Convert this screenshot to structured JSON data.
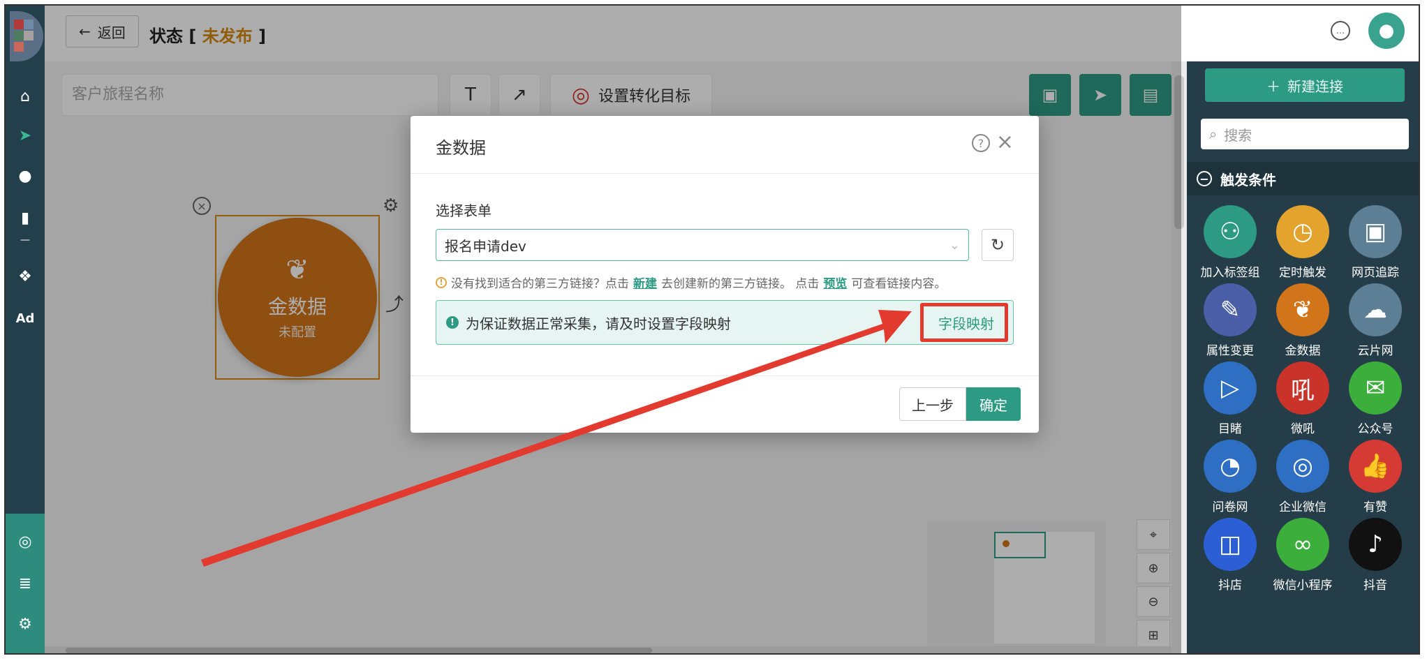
{
  "header": {
    "back_label": "返回",
    "title_prefix": "状态 [ ",
    "status": "未发布",
    "title_suffix": " ]"
  },
  "toolbar": {
    "journey_name_placeholder": "客户旅程名称",
    "text_tool": "T",
    "arrow_tool": "↗",
    "goal_label": "设置转化目标"
  },
  "node": {
    "title": "金数据",
    "subtitle": "未配置"
  },
  "modal": {
    "title": "金数据",
    "select_label": "选择表单",
    "selected_form": "报名申请dev",
    "hint_prefix": "没有找到适合的第三方链接？点击",
    "hint_new": "新建",
    "hint_middle": "去创建新的第三方链接。 点击",
    "hint_preview": "预览",
    "hint_suffix": "可查看链接内容。",
    "info_text": "为保证数据正常采集，请及时设置字段映射",
    "field_mapping": "字段映射",
    "prev_label": "上一步",
    "ok_label": "确定"
  },
  "right_panel": {
    "new_connection": "新建连接",
    "search_placeholder": "搜索",
    "section_title": "触发条件",
    "items": [
      {
        "label": "加入标签组",
        "icon": "user-add-icon",
        "color": "#2d9b83"
      },
      {
        "label": "定时触发",
        "icon": "clock-icon",
        "color": "#e3a32c"
      },
      {
        "label": "网页追踪",
        "icon": "webpage-icon",
        "color": "#5d7f95"
      },
      {
        "label": "属性变更",
        "icon": "edit-icon",
        "color": "#4a5fa8"
      },
      {
        "label": "金数据",
        "icon": "sprout-icon",
        "color": "#d2751a"
      },
      {
        "label": "云片网",
        "icon": "cloud-icon",
        "color": "#5d7f95"
      },
      {
        "label": "目睹",
        "icon": "play-icon",
        "color": "#2e6fc4"
      },
      {
        "label": "微吼",
        "icon": "vhall-icon",
        "color": "#c9332a"
      },
      {
        "label": "公众号",
        "icon": "wechat-icon",
        "color": "#3cae3c"
      },
      {
        "label": "问卷网",
        "icon": "survey-icon",
        "color": "#2e6fc4"
      },
      {
        "label": "企业微信",
        "icon": "work-wechat-icon",
        "color": "#2e6fc4"
      },
      {
        "label": "有赞",
        "icon": "thumb-icon",
        "color": "#d63a35"
      },
      {
        "label": "抖店",
        "icon": "doudian-icon",
        "color": "#2c5fd6"
      },
      {
        "label": "微信小程序",
        "icon": "miniprogram-icon",
        "color": "#3cae3c"
      },
      {
        "label": "抖音",
        "icon": "tiktok-icon",
        "color": "#111111"
      }
    ]
  }
}
